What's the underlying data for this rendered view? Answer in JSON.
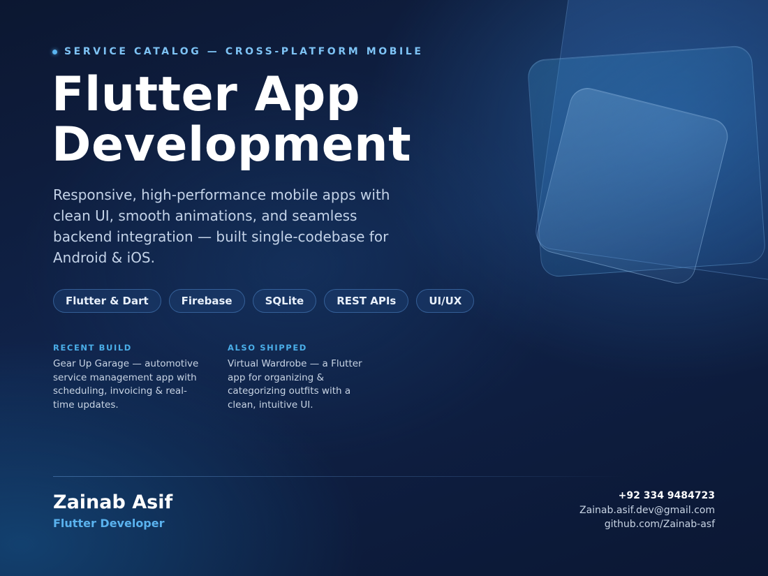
{
  "eyebrow": "SERVICE CATALOG — CROSS-PLATFORM MOBILE",
  "title": {
    "line1": "Flutter App",
    "line2": "Development"
  },
  "description": "Responsive, high-performance mobile apps with clean UI, smooth animations, and seamless backend integration — built single-codebase for Android & iOS.",
  "tags": [
    "Flutter & Dart",
    "Firebase",
    "SQLite",
    "REST APIs",
    "UI/UX"
  ],
  "projects": [
    {
      "label": "RECENT BUILD",
      "text": "Gear Up Garage — automotive service management app with scheduling, invoicing & real-time updates."
    },
    {
      "label": "ALSO SHIPPED",
      "text": "Virtual Wardrobe — a Flutter app for organizing & categorizing outfits with a clean, intuitive UI."
    }
  ],
  "profile": {
    "name": "Zainab Asif",
    "role": "Flutter Developer"
  },
  "contact": {
    "phone": "+92 334 9484723",
    "email": "Zainab.asif.dev@gmail.com",
    "github": "github.com/Zainab-asf"
  },
  "colors": {
    "accent": "#5ab2ee",
    "label": "#4aaee8",
    "background": "#0c1731"
  }
}
